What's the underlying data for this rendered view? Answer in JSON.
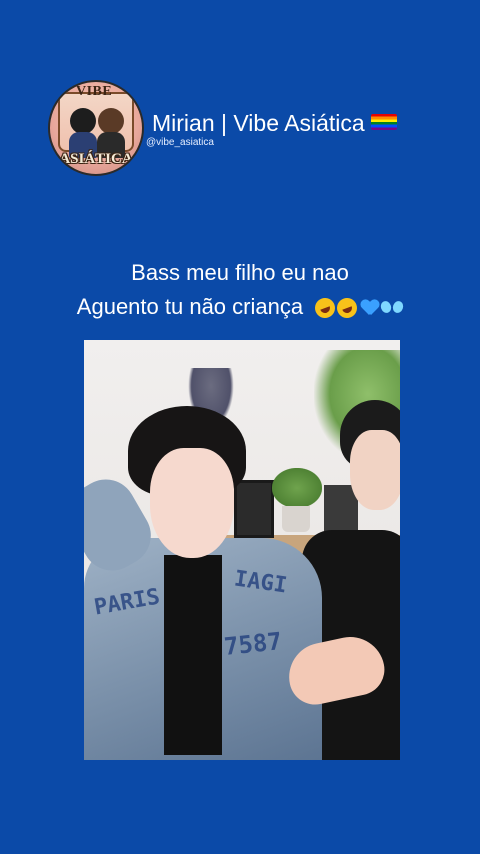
{
  "profile": {
    "avatar_top_text": "VIBE",
    "avatar_bottom_text": "ASIÁTICA",
    "display_name": "Mirian | Vibe Asiática",
    "handle": "@vibe_asiatica",
    "name_emoji": "rainbow-flag-icon"
  },
  "caption": {
    "line1": "Bass meu filho eu nao",
    "line2": "Aguento tu não criança",
    "emojis": [
      "rolling-laughing-icon",
      "rolling-laughing-icon",
      "blue-heart-icon",
      "butterfly-icon"
    ]
  },
  "video": {
    "graffiti_1": "PARIS",
    "graffiti_2": "IAGI",
    "graffiti_3": "7587"
  },
  "colors": {
    "background": "#0b4aa8",
    "text": "#ffffff"
  }
}
